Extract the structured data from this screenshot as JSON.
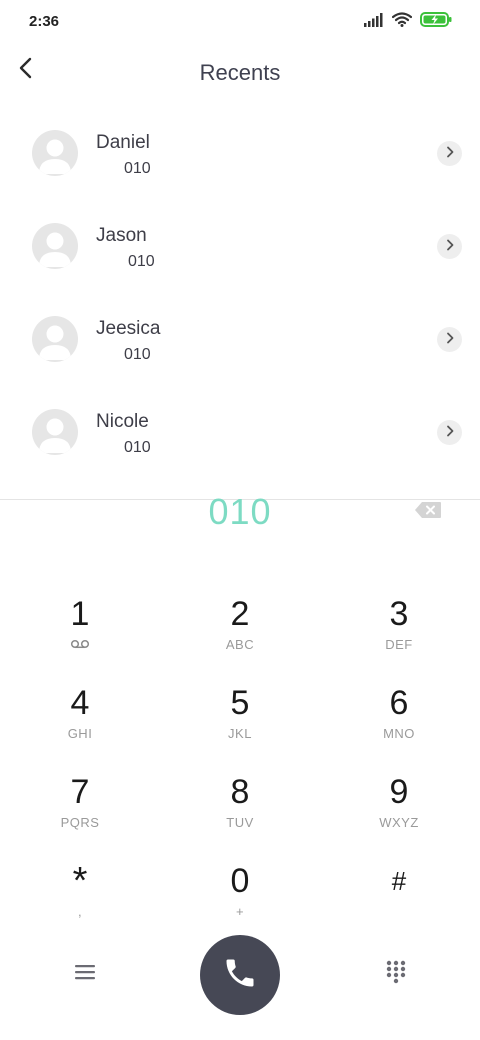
{
  "status_bar": {
    "time": "2:36",
    "icons": [
      "signal-icon",
      "wifi-icon",
      "battery-charging-icon"
    ],
    "battery_color": "#3cc13b"
  },
  "header": {
    "title": "Recents",
    "back_icon": "chevron-left-icon"
  },
  "recents": [
    {
      "name": "Daniel",
      "number": "010"
    },
    {
      "name": "Jason",
      "number": "010"
    },
    {
      "name": "Jeesica",
      "number": "010"
    },
    {
      "name": "Nicole",
      "number": "010"
    }
  ],
  "dialer": {
    "number": "010",
    "number_color": "#7ddbc3",
    "backspace_icon": "backspace-icon"
  },
  "keypad": [
    [
      {
        "digit": "1",
        "letters": "",
        "icon": "voicemail-icon"
      },
      {
        "digit": "2",
        "letters": "ABC"
      },
      {
        "digit": "3",
        "letters": "DEF"
      }
    ],
    [
      {
        "digit": "4",
        "letters": "GHI"
      },
      {
        "digit": "5",
        "letters": "JKL"
      },
      {
        "digit": "6",
        "letters": "MNO"
      }
    ],
    [
      {
        "digit": "7",
        "letters": "PQRS"
      },
      {
        "digit": "8",
        "letters": "TUV"
      },
      {
        "digit": "9",
        "letters": "WXYZ"
      }
    ],
    [
      {
        "digit": "*",
        "letters": ","
      },
      {
        "digit": "0",
        "letters": "+"
      },
      {
        "digit": "#",
        "letters": ""
      }
    ]
  ],
  "bottom_bar": {
    "menu_icon": "menu-icon",
    "call_icon": "phone-icon",
    "call_button_color": "#464855",
    "dialpad_icon": "dialpad-icon"
  }
}
